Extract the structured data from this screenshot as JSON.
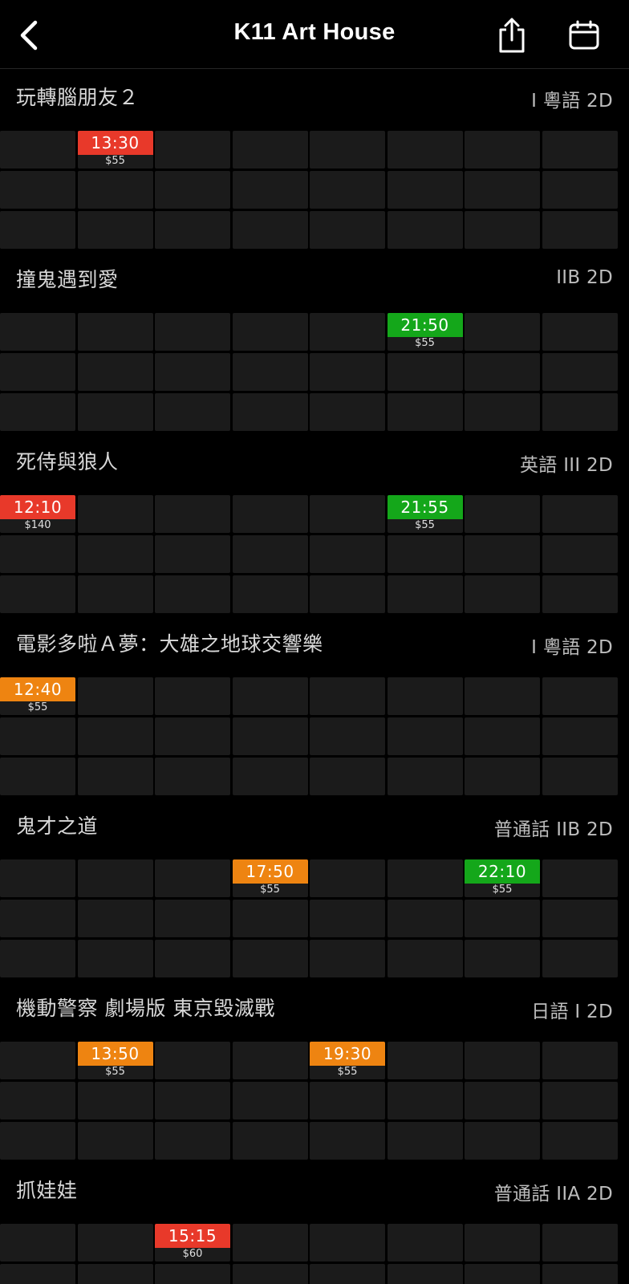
{
  "header": {
    "title": "K11 Art House",
    "back_icon": "chevron-left-icon",
    "share_icon": "share-icon",
    "calendar_icon": "calendar-icon"
  },
  "colors": {
    "background": "#000000",
    "cell": "#1b1b1b",
    "red": "#e8392a",
    "orange": "#ee8411",
    "green": "#14a71a"
  },
  "grid": {
    "rows": 3,
    "cols": 8
  },
  "movies": [
    {
      "title": "玩轉腦朋友２",
      "info": "I 粵語 2D",
      "showtimes": [
        {
          "row": 0,
          "col": 1,
          "time": "13:30",
          "price": "$55",
          "color": "red"
        }
      ]
    },
    {
      "title": "撞鬼遇到愛",
      "info": "IIB 2D",
      "showtimes": [
        {
          "row": 0,
          "col": 5,
          "time": "21:50",
          "price": "$55",
          "color": "green"
        }
      ]
    },
    {
      "title": "死侍與狼人",
      "info": "英語 III 2D",
      "showtimes": [
        {
          "row": 0,
          "col": 0,
          "time": "12:10",
          "price": "$140",
          "color": "red"
        },
        {
          "row": 0,
          "col": 5,
          "time": "21:55",
          "price": "$55",
          "color": "green"
        }
      ]
    },
    {
      "title": "電影多啦Ａ夢：大雄之地球交響樂",
      "info": "I 粵語 2D",
      "showtimes": [
        {
          "row": 0,
          "col": 0,
          "time": "12:40",
          "price": "$55",
          "color": "orange"
        }
      ]
    },
    {
      "title": "鬼才之道",
      "info": "普通話 IIB 2D",
      "showtimes": [
        {
          "row": 0,
          "col": 3,
          "time": "17:50",
          "price": "$55",
          "color": "orange"
        },
        {
          "row": 0,
          "col": 6,
          "time": "22:10",
          "price": "$55",
          "color": "green"
        }
      ]
    },
    {
      "title": "機動警察 劇場版 東京毀滅戰",
      "info": "日語 I 2D",
      "showtimes": [
        {
          "row": 0,
          "col": 1,
          "time": "13:50",
          "price": "$55",
          "color": "orange"
        },
        {
          "row": 0,
          "col": 4,
          "time": "19:30",
          "price": "$55",
          "color": "orange"
        }
      ]
    },
    {
      "title": "抓娃娃",
      "info": "普通話 IIA 2D",
      "showtimes": [
        {
          "row": 0,
          "col": 2,
          "time": "15:15",
          "price": "$60",
          "color": "red"
        }
      ]
    }
  ]
}
